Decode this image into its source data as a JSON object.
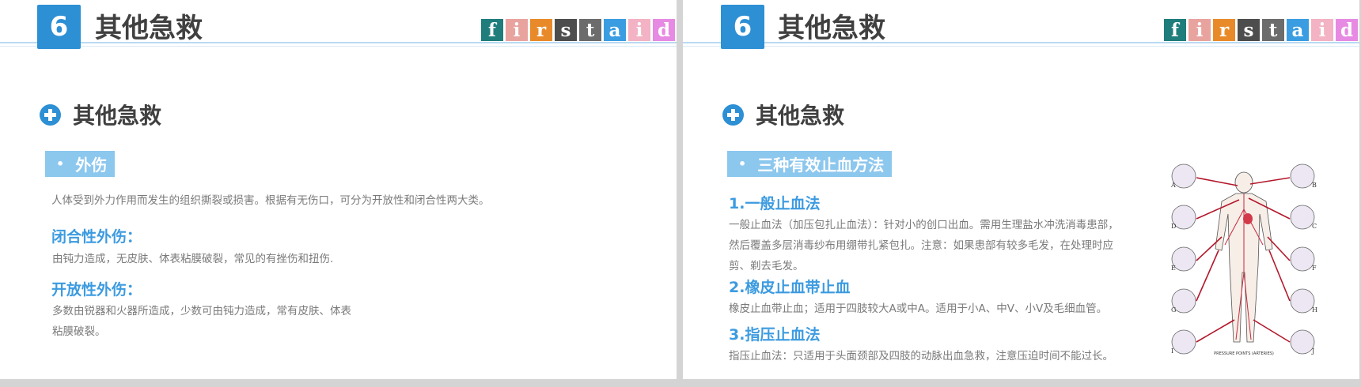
{
  "header": {
    "number": "6",
    "title": "其他急救"
  },
  "logo": {
    "letters": [
      "f",
      "i",
      "r",
      "s",
      "t",
      "a",
      "i",
      "d"
    ],
    "colors": [
      "#1f7d7c",
      "#e9a39f",
      "#e98a2a",
      "#4d4d4d",
      "#6c6c6c",
      "#3b9de1",
      "#f3b3c4",
      "#e78ae3"
    ]
  },
  "left": {
    "section_title": "其他急救",
    "label": "外伤",
    "intro": "人体受到外力作用而发生的组织撕裂或损害。根据有无伤口，可分为开放性和闭合性两大类。",
    "closed_heading": "闭合性外伤：",
    "closed_text": "由钝力造成，无皮肤、体表粘膜破裂，常见的有挫伤和扭伤.",
    "open_heading": "开放性外伤：",
    "open_text_line1": "多数由锐器和火器所造成，少数可由钝力造成，常有皮肤、体表",
    "open_text_line2": "粘膜破裂。"
  },
  "right": {
    "section_title": "其他急救",
    "label": "三种有效止血方法",
    "m1_heading": "1.一般止血法",
    "m1_line1": "一般止血法（加压包扎止血法）：针对小的创口出血。需用生理盐水冲洗消毒患部，",
    "m1_line2": "然后覆盖多层消毒纱布用绷带扎紧包扎。注意：如果患部有较多毛发，在处理时应",
    "m1_line3": "剪、剃去毛发。",
    "m2_heading": "2.橡皮止血带止血",
    "m2_text": "橡皮止血带止血；适用于四肢较大A或中A。适用于小A、中V、小V及毛细血管。",
    "m3_heading": "3.指压止血法",
    "m3_text": "指压止血法：只适用于头面颈部及四肢的动脉出血急救，注意压迫时间不能过长。",
    "illustration": {
      "left_letters": [
        "A",
        "D",
        "E",
        "G",
        "I"
      ],
      "right_letters": [
        "B",
        "C",
        "F",
        "H",
        "J"
      ],
      "caption": "PRESSURE POINTS (ARTERIES)"
    }
  }
}
